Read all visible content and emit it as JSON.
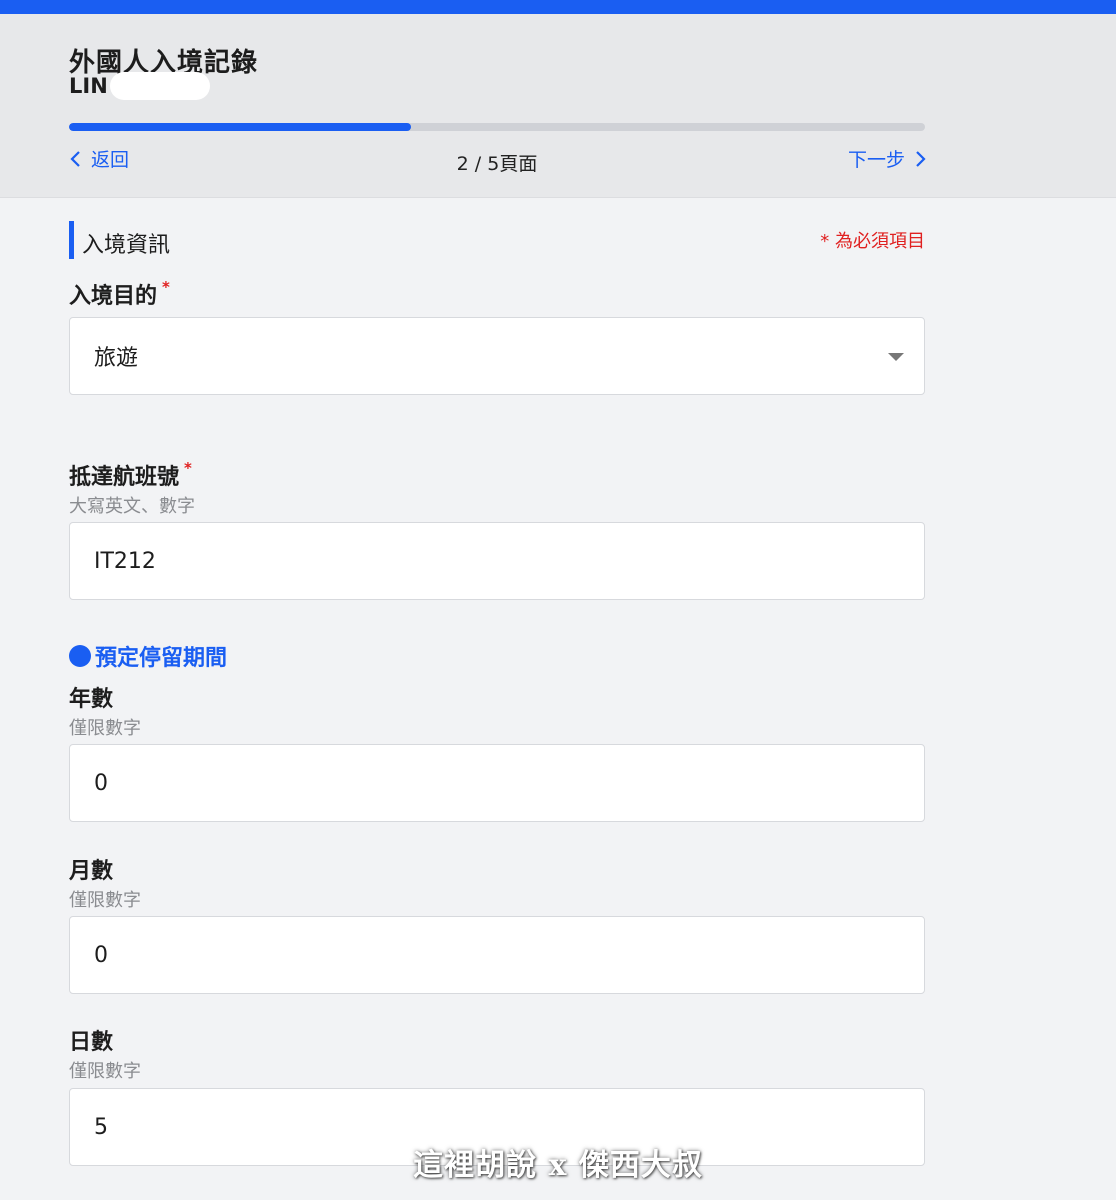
{
  "header": {
    "title": "外國人入境記錄",
    "name": "LIN",
    "progress_fraction": 0.4,
    "back_label": "返回",
    "page_indicator": "2 / 5頁面",
    "next_label": "下一步"
  },
  "section": {
    "title": "入境資訊",
    "required_note": "* 為必須項目"
  },
  "fields": {
    "purpose": {
      "label": "入境目的",
      "value": "旅遊"
    },
    "flight": {
      "label": "抵達航班號",
      "hint": "大寫英文、數字",
      "value": "IT212"
    }
  },
  "stay": {
    "title": "預定停留期間",
    "years": {
      "label": "年數",
      "hint": "僅限數字",
      "value": "0"
    },
    "months": {
      "label": "月數",
      "hint": "僅限數字",
      "value": "0"
    },
    "days": {
      "label": "日數",
      "hint": "僅限數字",
      "value": "5"
    }
  },
  "watermark": "這裡胡說 x 傑西大叔",
  "colors": {
    "accent": "#1a5ef2",
    "required": "#e02020"
  }
}
